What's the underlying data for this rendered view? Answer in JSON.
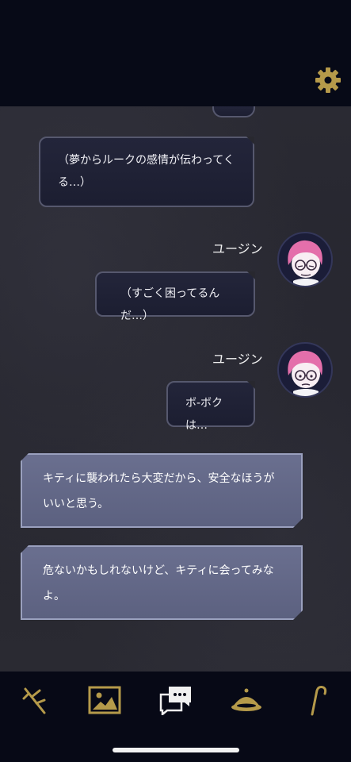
{
  "colors": {
    "accent_gold": "#b59a4a",
    "choice_bg": "#62678a",
    "bubble_bg": "#202236",
    "topbar_bg": "#070a17"
  },
  "header": {
    "settings_icon": "gear-icon"
  },
  "messages": [
    {
      "speaker": "",
      "text": ""
    },
    {
      "speaker": "",
      "text": "（夢からルークの感情が伝わってくる…）"
    },
    {
      "speaker": "ユージン",
      "text": "（すごく困ってるんだ…）"
    },
    {
      "speaker": "ユージン",
      "text": "ボ-ボクは…"
    }
  ],
  "choices": [
    {
      "text": "キティに襲われたら大変だから、安全なほうがいいと思う。"
    },
    {
      "text": "危ないかもしれないけど、キティに会ってみなよ。"
    }
  ],
  "nav": {
    "items": [
      {
        "icon": "branch-icon"
      },
      {
        "icon": "picture-icon"
      },
      {
        "icon": "chat-icon"
      },
      {
        "icon": "dome-icon"
      },
      {
        "icon": "cane-icon"
      }
    ]
  }
}
